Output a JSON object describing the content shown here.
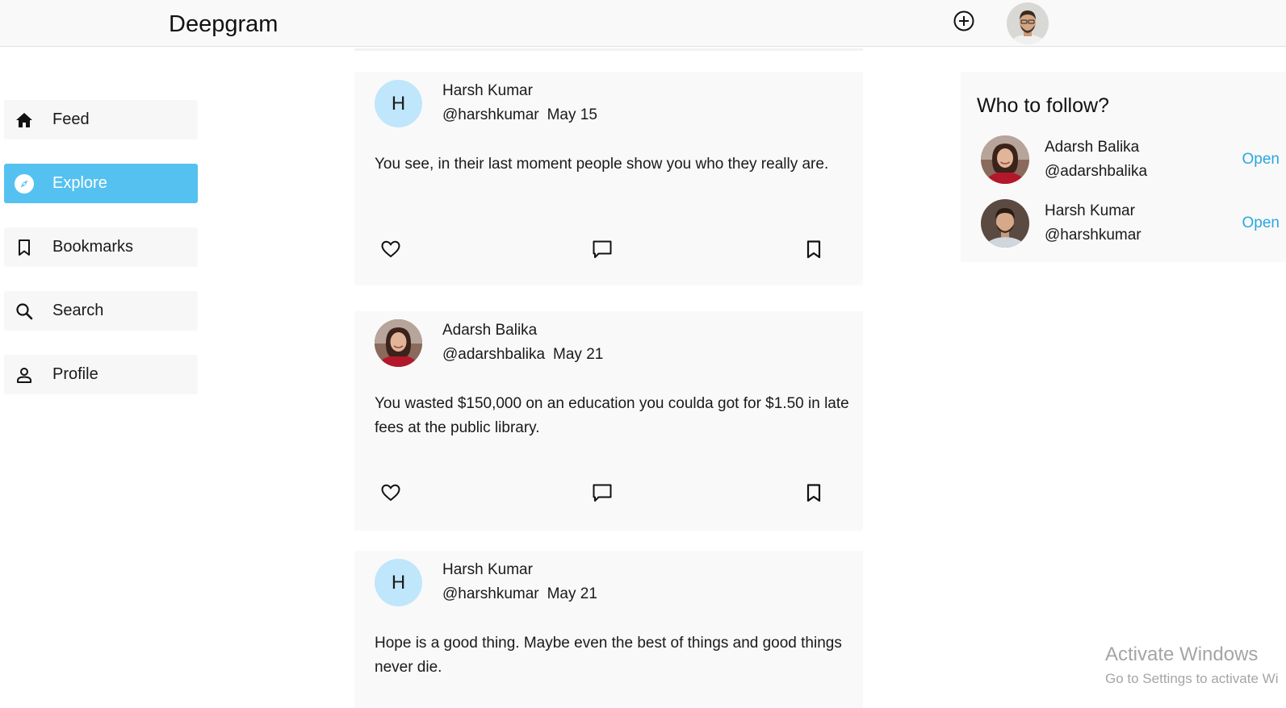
{
  "header": {
    "brand": "Deepgram",
    "create_icon": "plus-circle-icon",
    "avatar": "user-avatar"
  },
  "nav": {
    "items": [
      {
        "label": "Feed",
        "icon": "home-icon",
        "active": false
      },
      {
        "label": "Explore",
        "icon": "compass-icon",
        "active": true
      },
      {
        "label": "Bookmarks",
        "icon": "bookmark-icon",
        "active": false
      },
      {
        "label": "Search",
        "icon": "search-icon",
        "active": false
      },
      {
        "label": "Profile",
        "icon": "person-icon",
        "active": false
      }
    ]
  },
  "posts": [
    {
      "avatar_letter": "H",
      "name": "Harsh Kumar",
      "handle": "@harshkumar",
      "date": "May 15",
      "text": "You see, in their last moment people show you who they really are."
    },
    {
      "avatar_letter": "",
      "name": "Adarsh Balika",
      "handle": "@adarshbalika",
      "date": "May 21",
      "text": "You wasted $150,000 on an education you coulda got for $1.50 in late fees at the public library."
    },
    {
      "avatar_letter": "H",
      "name": "Harsh Kumar",
      "handle": "@harshkumar",
      "date": "May 21",
      "text": "Hope is a good thing. Maybe even the best of things and good things never die."
    }
  ],
  "who_to_follow": {
    "title": "Who to follow?",
    "users": [
      {
        "name": "Adarsh Balika",
        "handle": "@adarshbalika",
        "action": "Open"
      },
      {
        "name": "Harsh Kumar",
        "handle": "@harshkumar",
        "action": "Open"
      }
    ]
  },
  "watermark": {
    "line1": "Activate Windows",
    "line2": "Go to Settings to activate Wi"
  },
  "colors": {
    "accent": "#55c1f0",
    "link": "#2aa7e0",
    "avatar_bg": "#bfe6fb",
    "card_bg": "#f9f9f9"
  }
}
